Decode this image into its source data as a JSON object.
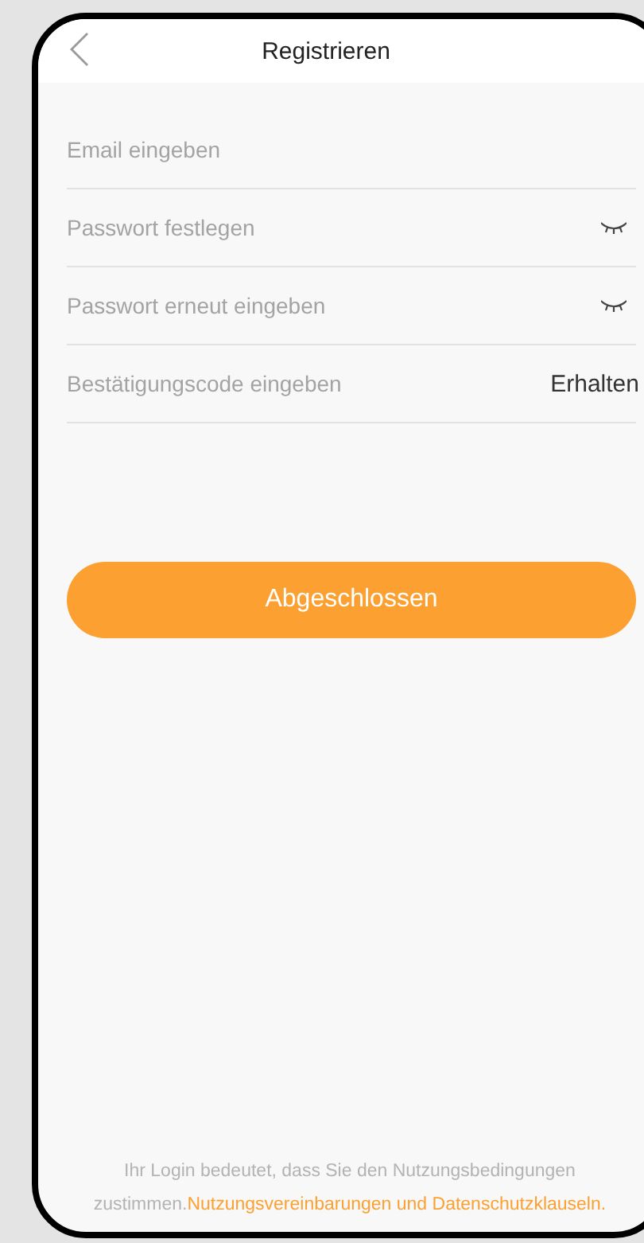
{
  "header": {
    "title": "Registrieren"
  },
  "fields": [
    {
      "kind": "email",
      "placeholder": "Email eingeben"
    },
    {
      "kind": "password",
      "placeholder": "Passwort festlegen",
      "visible": false
    },
    {
      "kind": "password",
      "placeholder": "Passwort erneut eingeben",
      "visible": false
    },
    {
      "kind": "code",
      "placeholder": "Bestätigungscode eingeben",
      "action": "Erhalten"
    }
  ],
  "submit": {
    "label": "Abgeschlossen"
  },
  "footer": {
    "text": "Ihr Login bedeutet, dass Sie den Nutzungsbedingungen zustimmen.",
    "link": "Nutzungsvereinbarungen und Datenschutzklauseln."
  }
}
